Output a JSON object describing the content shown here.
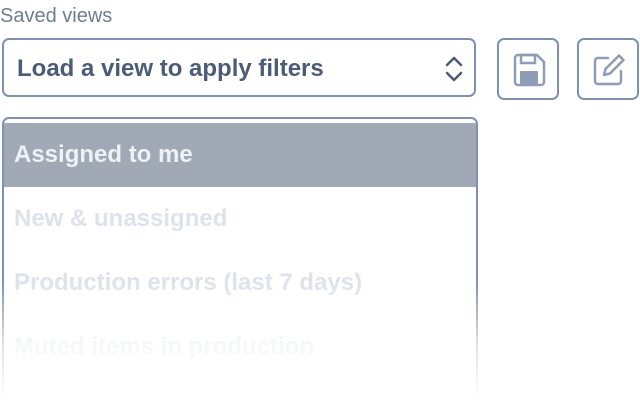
{
  "saved_views": {
    "label": "Saved views",
    "select": {
      "current_value": "Load a view to apply filters",
      "caret_icon": "chevron-up-down-icon"
    },
    "buttons": {
      "save_icon": "floppy-disk-icon",
      "edit_icon": "pencil-square-icon"
    },
    "menu": {
      "items": [
        {
          "label": "Assigned to me",
          "highlighted": true
        },
        {
          "label": "New & unassigned",
          "highlighted": false
        },
        {
          "label": "Production errors (last 7 days)",
          "highlighted": false
        },
        {
          "label": "Muted items in production",
          "highlighted": false
        }
      ]
    }
  },
  "colors": {
    "border": "#7f91b0",
    "label_text": "#6f7d93",
    "value_text": "#4c5c78",
    "highlight_bg": "#a1a9b6",
    "item_text": "#dde2eb"
  }
}
